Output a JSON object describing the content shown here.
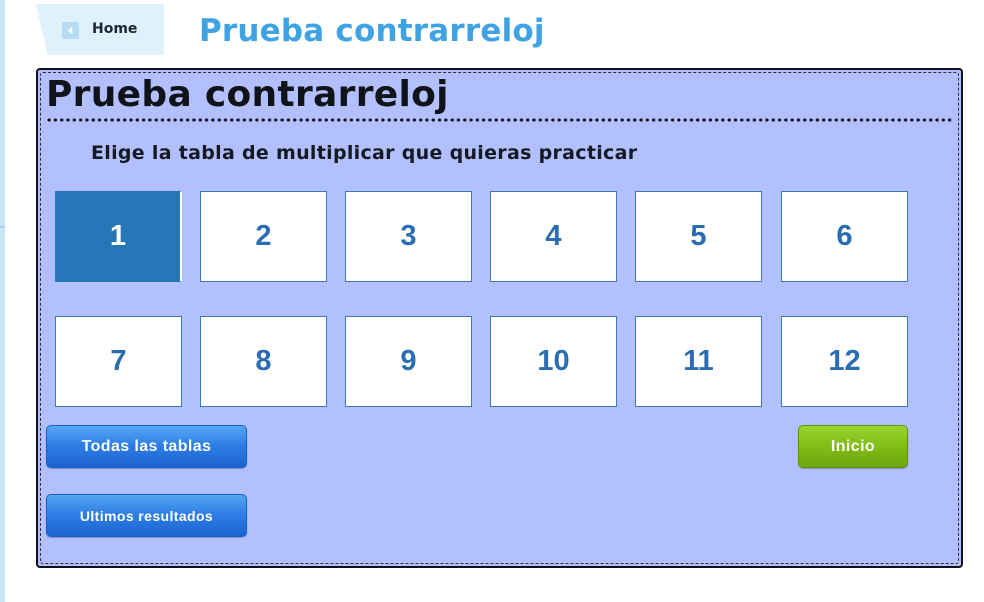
{
  "nav": {
    "home_label": "Home",
    "page_title": "Prueba contrarreloj"
  },
  "panel": {
    "title": "Prueba contrarreloj",
    "instruction": "Elige la tabla de multiplicar que quieras practicar",
    "tables": [
      "1",
      "2",
      "3",
      "4",
      "5",
      "6",
      "7",
      "8",
      "9",
      "10",
      "11",
      "12"
    ],
    "selected_table": "1",
    "all_tables_label": "Todas las tablas",
    "last_results_label": "Ultimos resultados",
    "start_label": "Inicio"
  },
  "colors": {
    "accent_blue": "#3fa3e3",
    "panel_background": "#b2c0ff",
    "tile_selected": "#2776b7",
    "tile_text": "#2a6db1",
    "button_blue": "#2f7fe6",
    "button_green": "#80bd16"
  },
  "icons": {
    "home": "chevron-left-icon"
  }
}
